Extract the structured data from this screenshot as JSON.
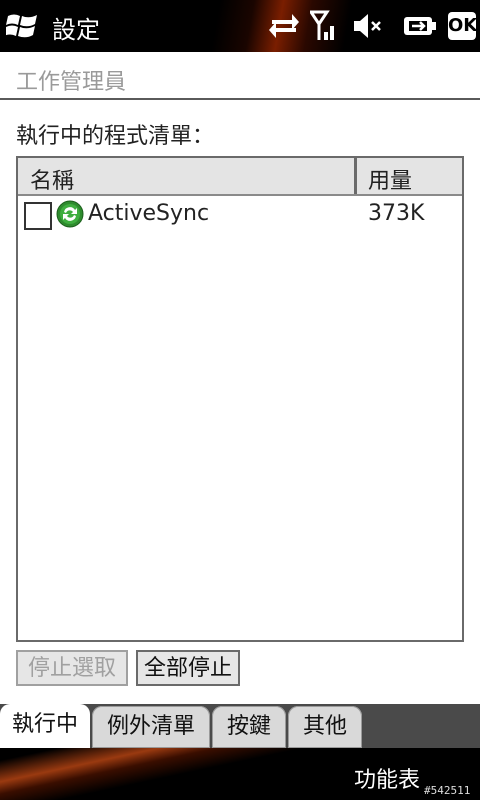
{
  "statusbar": {
    "title": "設定",
    "ok_label": "OK",
    "icons": [
      "windows-start-icon",
      "data-transfer-icon",
      "signal-icon",
      "volume-mute-icon",
      "battery-charging-icon",
      "ok-button"
    ]
  },
  "page": {
    "title": "工作管理員"
  },
  "list": {
    "caption": "執行中的程式清單：",
    "columns": [
      "名稱",
      "用量"
    ],
    "rows": [
      {
        "name": "ActiveSync",
        "usage": "373K",
        "checked": false
      }
    ]
  },
  "buttons": {
    "stop_selected": "停止選取",
    "stop_all": "全部停止"
  },
  "tabs": [
    {
      "label": "執行中",
      "active": true
    },
    {
      "label": "例外清單",
      "active": false
    },
    {
      "label": "按鍵",
      "active": false
    },
    {
      "label": "其他",
      "active": false
    }
  ],
  "softkeys": {
    "menu": "功能表"
  },
  "watermark": "#542511",
  "colors": {
    "accent": "#7a1e00",
    "icon_green": "#2e8b2e"
  }
}
